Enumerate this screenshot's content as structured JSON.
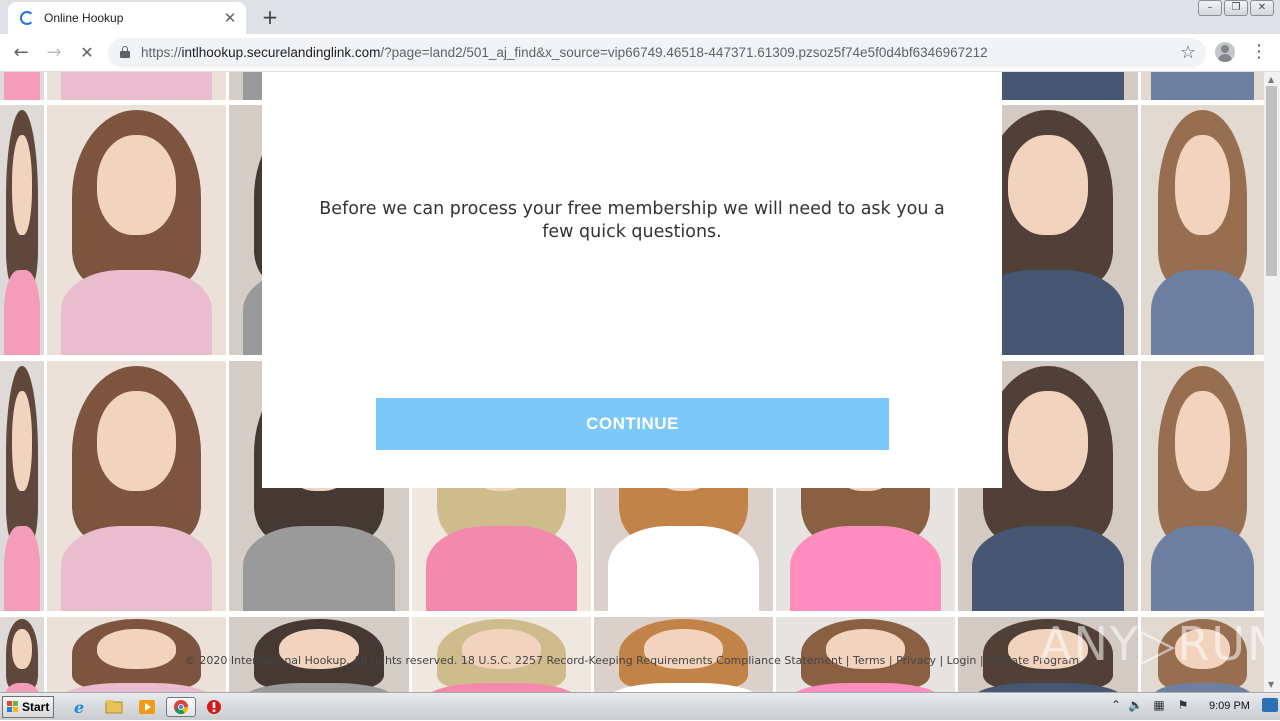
{
  "browser": {
    "tab_title": "Online Hookup",
    "tab_close": "✕",
    "new_tab": "+",
    "url_scheme": "https://",
    "url_host": "intlhookup.securelandinglink.com",
    "url_path": "/?page=land2/501_aj_find&x_source=vip66749.46518-447371.61309.pzsoz5f74e5f0d4bf6346967212",
    "back": "←",
    "forward": "→",
    "stop": "✕",
    "star": "☆",
    "menu": "⋮",
    "win_minimize": "–",
    "win_restore": "❐",
    "win_close": "✕"
  },
  "modal": {
    "message": "Before we can process your free membership we will need to ask you a few quick questions.",
    "continue_label": "CONTINUE"
  },
  "footer": {
    "copyright": "© 2020 International Hookup. All rights reserved. 18 U.S.C. 2257 Record-Keeping Requirements Compliance Statement",
    "sep": "|",
    "terms": "Terms",
    "privacy": "Privacy",
    "login": "Login",
    "affiliate": "Affiliate Program"
  },
  "watermark": "ANY▷RUN",
  "taskbar": {
    "start_label": "Start",
    "clock": "9:09 PM",
    "tray_expand": "⌃"
  },
  "colors": {
    "continue_button": "#7cc8f8",
    "tab_spinner": "#1a73e8"
  },
  "icons": [
    "loading-spinner-icon",
    "back-arrow-icon",
    "forward-arrow-icon",
    "stop-icon",
    "lock-icon",
    "star-icon",
    "profile-icon",
    "menu-icon",
    "windows-logo-icon",
    "ie-icon",
    "folder-icon",
    "media-player-icon",
    "chrome-icon",
    "opera-icon",
    "volume-icon",
    "network-icon",
    "flag-icon",
    "show-desktop-icon"
  ]
}
